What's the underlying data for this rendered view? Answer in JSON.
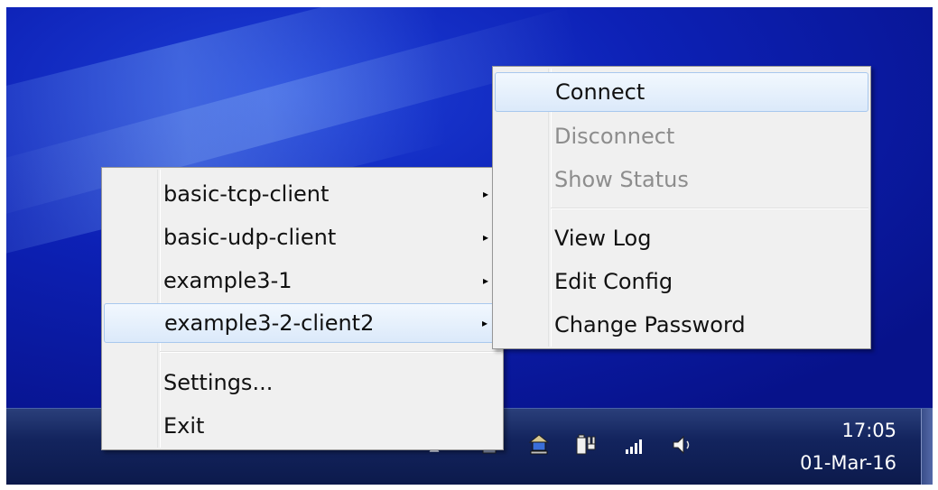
{
  "main_menu": {
    "items": [
      {
        "label": "basic-tcp-client",
        "arrow": "▸"
      },
      {
        "label": "basic-udp-client",
        "arrow": "▸"
      },
      {
        "label": "example3-1",
        "arrow": "▸"
      },
      {
        "label": "example3-2-client2",
        "arrow": "▸"
      }
    ],
    "settings_label": "Settings...",
    "exit_label": "Exit"
  },
  "submenu": {
    "connect_label": "Connect",
    "disconnect_label": "Disconnect",
    "show_status_label": "Show Status",
    "view_log_label": "View Log",
    "edit_config_label": "Edit Config",
    "change_password_label": "Change Password"
  },
  "tray": {
    "icons": [
      "show-hidden-icons-icon",
      "openvpn-icon",
      "network-computer-icon",
      "power-icon",
      "signal-icon",
      "volume-icon"
    ],
    "time": "17:05",
    "date": "01-Mar-16"
  },
  "colors": {
    "desktop": "#0d21b6",
    "menu_bg": "#f0f0f0",
    "highlight": "#dbe9fa",
    "disabled_text": "#8d8d8d"
  }
}
